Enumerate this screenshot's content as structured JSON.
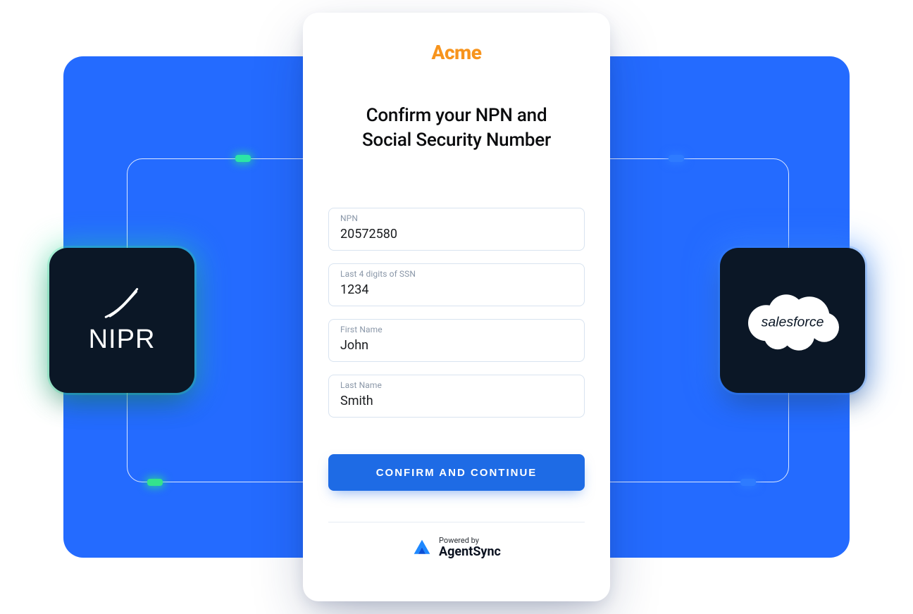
{
  "brand": "Acme",
  "title_line1": "Confirm your NPN and",
  "title_line2": "Social Security Number",
  "fields": {
    "npn": {
      "label": "NPN",
      "value": "20572580"
    },
    "ssn": {
      "label": "Last 4 digits of SSN",
      "value": "1234"
    },
    "first": {
      "label": "First Name",
      "value": "John"
    },
    "last": {
      "label": "Last Name",
      "value": "Smith"
    }
  },
  "cta_label": "CONFIRM AND CONTINUE",
  "powered": {
    "small": "Powered by",
    "name": "AgentSync"
  },
  "integrations": {
    "left": "NIPR",
    "right": "salesforce"
  },
  "colors": {
    "primary": "#246BFF",
    "accent": "#F7941D",
    "cta": "#1E6BE5"
  }
}
